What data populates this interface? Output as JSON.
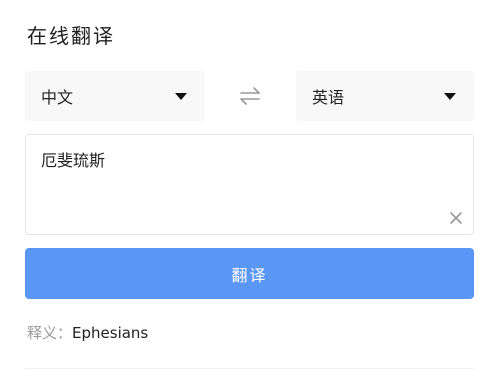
{
  "header": {
    "title": "在线翻译"
  },
  "source_lang": {
    "selected": "中文"
  },
  "target_lang": {
    "selected": "英语"
  },
  "input": {
    "value": "厄斐琉斯"
  },
  "actions": {
    "translate_label": "翻译"
  },
  "result": {
    "label": "释义：",
    "value": "Ephesians"
  },
  "colors": {
    "accent": "#5a97f5",
    "select_bg": "#f8f8f8",
    "muted_text": "#9a9a9a"
  },
  "icons": {
    "swap": "swap-arrows-icon",
    "clear": "close-icon",
    "dropdown": "caret-down-icon"
  }
}
